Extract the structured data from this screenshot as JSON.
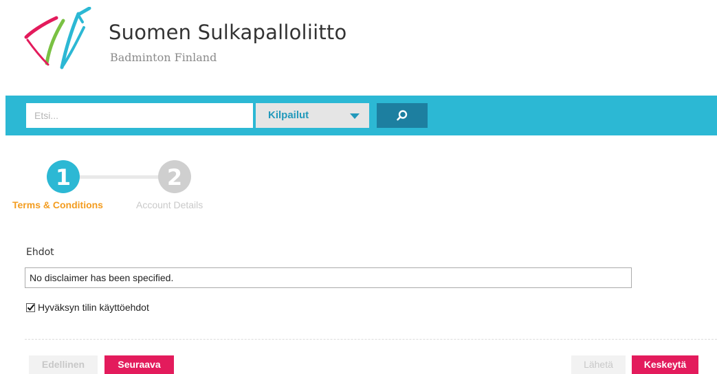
{
  "brand": {
    "title": "Suomen Sulkapalloliitto",
    "subtitle": "Badminton Finland",
    "logo_icon": "shuttlecock-logo-icon",
    "colors": {
      "accent": "#2cb8d4",
      "magenta": "#e31b5c",
      "green": "#7ac143",
      "orange": "#f39c1f"
    }
  },
  "search": {
    "placeholder": "Etsi...",
    "value": "",
    "category": "Kilpailut",
    "button_icon": "search-icon"
  },
  "steps": [
    {
      "number": "1",
      "label": "Terms & Conditions",
      "state": "active"
    },
    {
      "number": "2",
      "label": "Account Details",
      "state": "inactive"
    }
  ],
  "terms": {
    "title": "Ehdot",
    "disclaimer": "No disclaimer has been specified.",
    "accept_label": "Hyväksyn tilin käyttöehdot",
    "accept_checked": true
  },
  "buttons": {
    "previous": "Edellinen",
    "next": "Seuraava",
    "send": "Lähetä",
    "cancel": "Keskeytä"
  }
}
